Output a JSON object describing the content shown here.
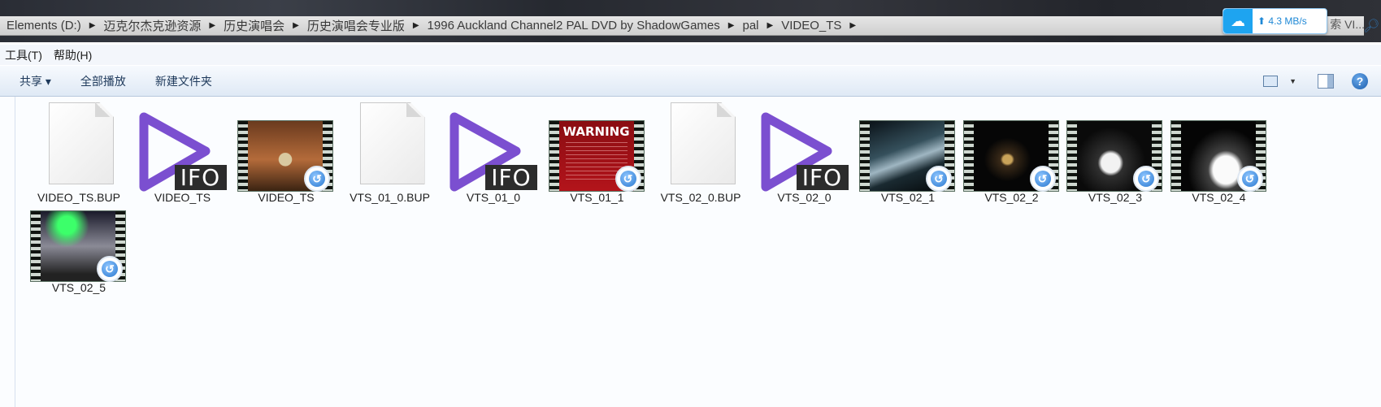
{
  "address": {
    "crumbs": [
      "Elements (D:)",
      "迈克尔杰克逊资源",
      "历史演唱会",
      "历史演唱会专业版",
      "1996 Auckland Channel2 PAL DVD by ShadowGames",
      "pal",
      "VIDEO_TS"
    ],
    "search_tail": "索 VI..."
  },
  "speed": {
    "text": "⬆ 4.3 MB/s"
  },
  "menu": {
    "tools": "工具(T)",
    "help": "帮助(H)"
  },
  "toolbar": {
    "share": "共享 ▾",
    "play_all": "全部播放",
    "new_folder": "新建文件夹",
    "help_glyph": "?"
  },
  "files": [
    {
      "name": "VIDEO_TS.BUP",
      "kind": "blank"
    },
    {
      "name": "VIDEO_TS",
      "kind": "ifo"
    },
    {
      "name": "VIDEO_TS",
      "kind": "video",
      "thumb": "history"
    },
    {
      "name": "VTS_01_0.BUP",
      "kind": "blank"
    },
    {
      "name": "VTS_01_0",
      "kind": "ifo"
    },
    {
      "name": "VTS_01_1",
      "kind": "video",
      "thumb": "warning"
    },
    {
      "name": "VTS_02_0.BUP",
      "kind": "blank"
    },
    {
      "name": "VTS_02_0",
      "kind": "ifo"
    },
    {
      "name": "VTS_02_1",
      "kind": "video",
      "thumb": "stage"
    },
    {
      "name": "VTS_02_2",
      "kind": "video",
      "thumb": "dark"
    },
    {
      "name": "VTS_02_3",
      "kind": "video",
      "thumb": "white"
    },
    {
      "name": "VTS_02_4",
      "kind": "video",
      "thumb": "singer"
    },
    {
      "name": "VTS_02_5",
      "kind": "video",
      "thumb": "green"
    }
  ],
  "labels": {
    "ifo": "IFO",
    "warning": "WARNING"
  },
  "colors": {
    "ifo_purple": "#7b4fd0",
    "accent_blue": "#1ea4f0"
  }
}
